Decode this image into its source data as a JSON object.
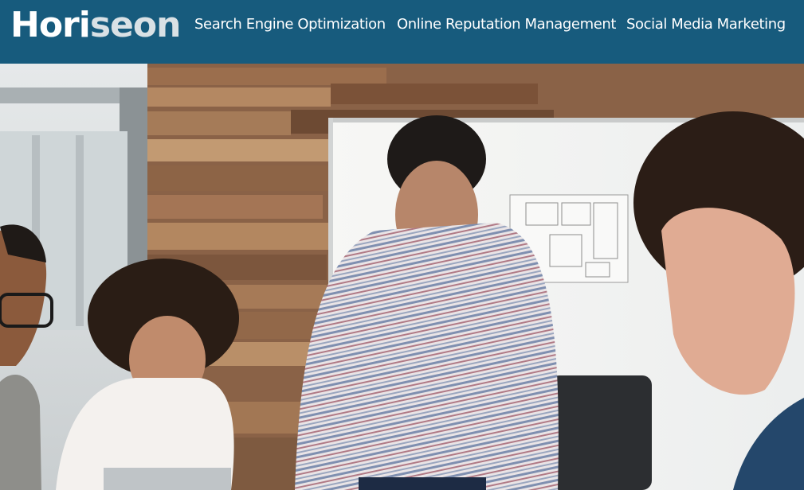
{
  "header": {
    "logo_primary": "Hori",
    "logo_accent": "seon",
    "nav": [
      {
        "label": "Search Engine Optimization"
      },
      {
        "label": "Online Reputation Management"
      },
      {
        "label": "Social Media Marketing"
      }
    ]
  },
  "colors": {
    "header_bg": "#175b7d",
    "logo_accent": "#d9e1e5",
    "nav_text": "#ffffff"
  },
  "hero": {
    "image_subject": "hero-team-meeting-photo"
  }
}
